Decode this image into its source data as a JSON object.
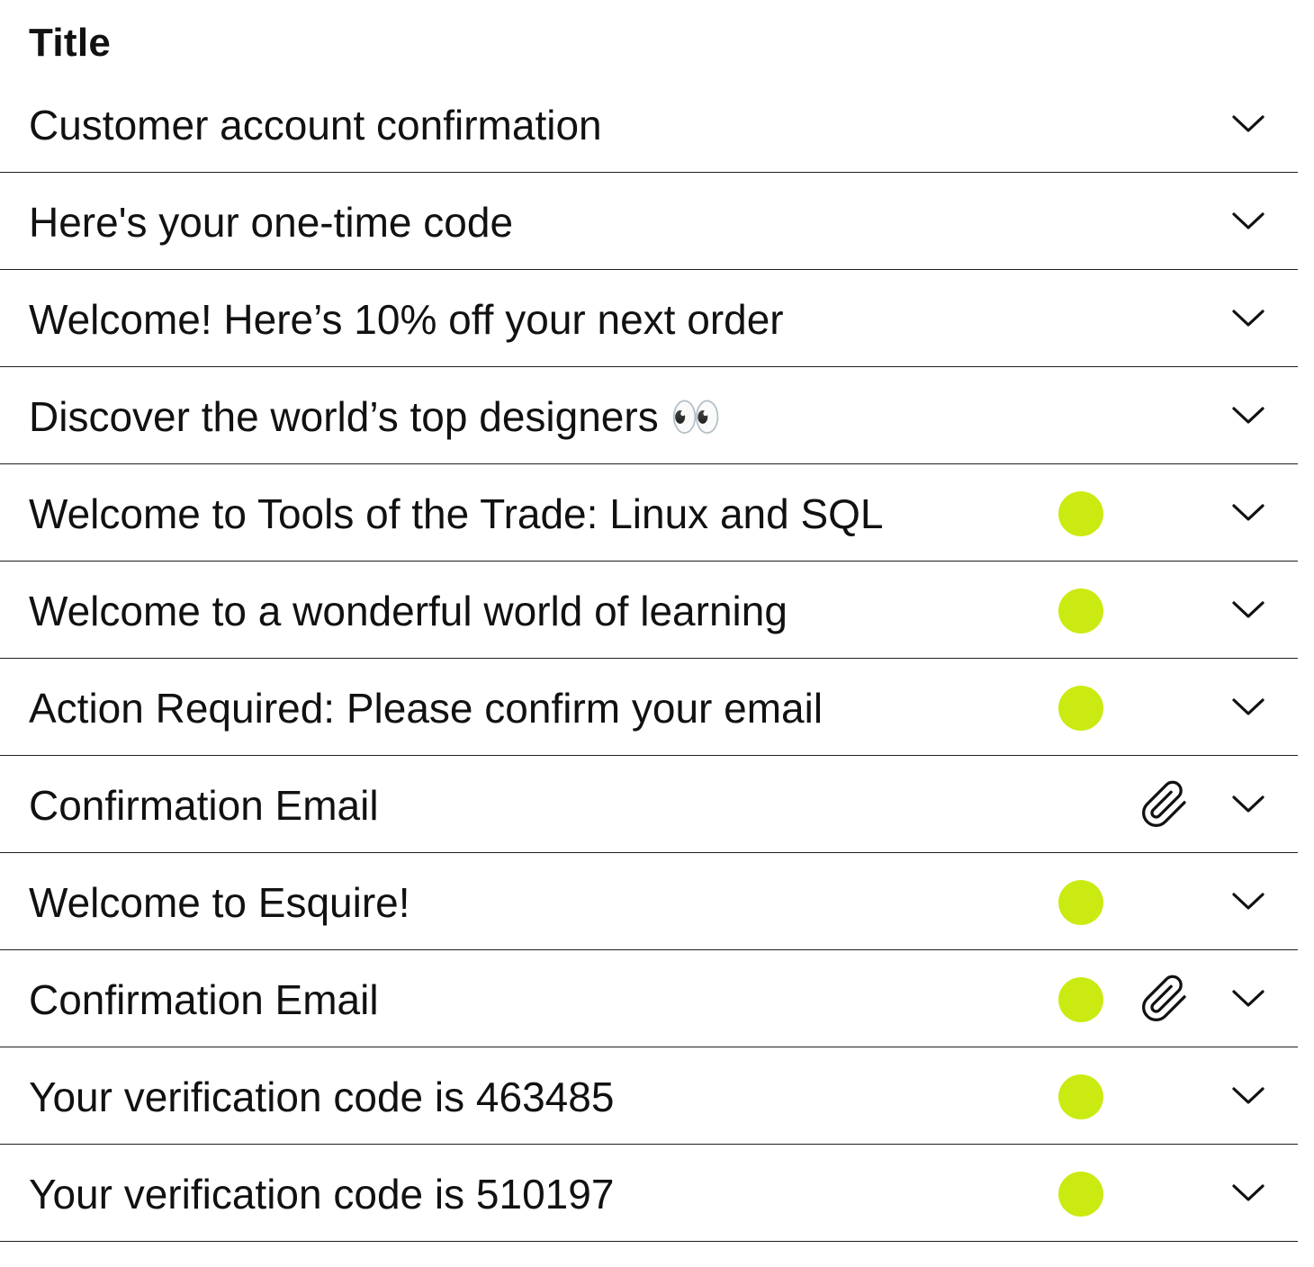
{
  "header": {
    "title": "Title"
  },
  "colors": {
    "unread_dot": "#CBEA12",
    "divider": "#1f1f1f",
    "text": "#111111"
  },
  "rows": [
    {
      "title": "Customer account confirmation",
      "unread": false,
      "attachment": false,
      "chevron_icon": "chevron-down-icon"
    },
    {
      "title": "Here's your one-time code",
      "unread": false,
      "attachment": false,
      "chevron_icon": "chevron-down-icon"
    },
    {
      "title": "Welcome! Here’s 10% off your next order",
      "unread": false,
      "attachment": false,
      "chevron_icon": "chevron-down-icon"
    },
    {
      "title": "Discover the world’s top designers 👀",
      "unread": false,
      "attachment": false,
      "chevron_icon": "chevron-down-icon"
    },
    {
      "title": "Welcome to Tools of the Trade: Linux and SQL",
      "unread": true,
      "attachment": false,
      "chevron_icon": "chevron-down-icon"
    },
    {
      "title": "Welcome to a wonderful world of learning",
      "unread": true,
      "attachment": false,
      "chevron_icon": "chevron-down-icon"
    },
    {
      "title": "Action Required: Please confirm your email",
      "unread": true,
      "attachment": false,
      "chevron_icon": "chevron-down-icon"
    },
    {
      "title": "Confirmation Email",
      "unread": false,
      "attachment": true,
      "chevron_icon": "chevron-down-icon"
    },
    {
      "title": "Welcome to Esquire!",
      "unread": true,
      "attachment": false,
      "chevron_icon": "chevron-down-icon"
    },
    {
      "title": "Confirmation Email",
      "unread": true,
      "attachment": true,
      "chevron_icon": "chevron-down-icon"
    },
    {
      "title": "Your verification code is 463485",
      "unread": true,
      "attachment": false,
      "chevron_icon": "chevron-down-icon"
    },
    {
      "title": "Your verification code is 510197",
      "unread": true,
      "attachment": false,
      "chevron_icon": "chevron-down-icon"
    }
  ]
}
